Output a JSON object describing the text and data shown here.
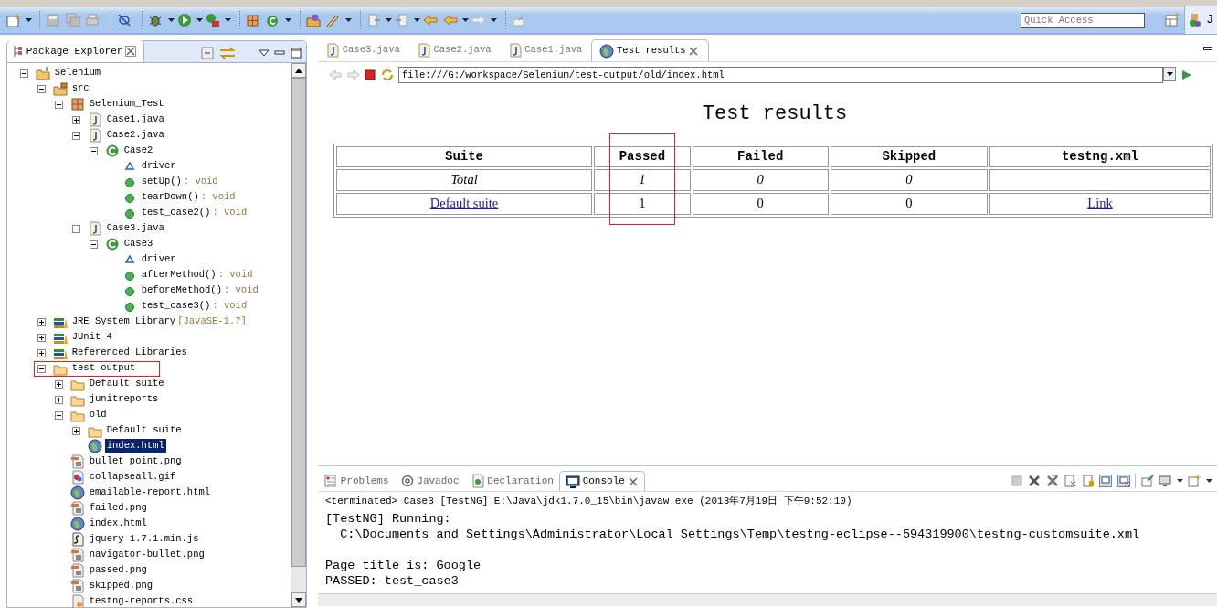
{
  "toolbar": {
    "quick_access": {
      "placeholder": "Quick Access"
    },
    "perspective_label": "J"
  },
  "package_explorer": {
    "title": "Package Explorer",
    "tree": [
      {
        "label": "Selenium",
        "kind": "project",
        "expanded": true,
        "children": [
          {
            "label": "src",
            "kind": "source-folder",
            "expanded": true,
            "children": [
              {
                "label": "Selenium_Test",
                "kind": "package",
                "expanded": true,
                "children": [
                  {
                    "label": "Case1.java",
                    "kind": "java-file",
                    "expanded": false
                  },
                  {
                    "label": "Case2.java",
                    "kind": "java-file",
                    "expanded": true,
                    "children": [
                      {
                        "label": "Case2",
                        "kind": "class",
                        "expanded": true,
                        "children": [
                          {
                            "label": "driver",
                            "kind": "field"
                          },
                          {
                            "label": "setUp()",
                            "suffix": " : void",
                            "kind": "method"
                          },
                          {
                            "label": "tearDown()",
                            "suffix": " : void",
                            "kind": "method"
                          },
                          {
                            "label": "test_case2()",
                            "suffix": " : void",
                            "kind": "method"
                          }
                        ]
                      }
                    ]
                  },
                  {
                    "label": "Case3.java",
                    "kind": "java-file",
                    "expanded": true,
                    "children": [
                      {
                        "label": "Case3",
                        "kind": "class",
                        "expanded": true,
                        "children": [
                          {
                            "label": "driver",
                            "kind": "field"
                          },
                          {
                            "label": "afterMethod()",
                            "suffix": " : void",
                            "kind": "method"
                          },
                          {
                            "label": "beforeMethod()",
                            "suffix": " : void",
                            "kind": "method"
                          },
                          {
                            "label": "test_case3()",
                            "suffix": " : void",
                            "kind": "method"
                          }
                        ]
                      }
                    ]
                  }
                ]
              }
            ]
          },
          {
            "label": "JRE System Library",
            "suffix": " [JavaSE-1.7]",
            "kind": "library",
            "expanded": false
          },
          {
            "label": "JUnit 4",
            "kind": "library",
            "expanded": false
          },
          {
            "label": "Referenced Libraries",
            "kind": "library",
            "expanded": false
          },
          {
            "label": "test-output",
            "kind": "folder",
            "expanded": true,
            "highlighted": true,
            "children": [
              {
                "label": "Default suite",
                "kind": "folder",
                "expanded": false
              },
              {
                "label": "junitreports",
                "kind": "folder",
                "expanded": false
              },
              {
                "label": "old",
                "kind": "folder",
                "expanded": true,
                "children": [
                  {
                    "label": "Default suite",
                    "kind": "folder",
                    "expanded": false
                  },
                  {
                    "label": "index.html",
                    "kind": "web-file",
                    "selected": true
                  }
                ]
              },
              {
                "label": "bullet_point.png",
                "kind": "image-file",
                "selected": false
              },
              {
                "label": "collapseall.gif",
                "kind": "gif-file",
                "selected": false
              },
              {
                "label": "emailable-report.html",
                "kind": "web-file",
                "selected": false
              },
              {
                "label": "failed.png",
                "kind": "image-file",
                "selected": false
              },
              {
                "label": "index.html",
                "kind": "web-file",
                "selected": false
              },
              {
                "label": "jquery-1.7.1.min.js",
                "kind": "script-file",
                "selected": false
              },
              {
                "label": "navigator-bullet.png",
                "kind": "image-file",
                "selected": false
              },
              {
                "label": "passed.png",
                "kind": "image-file",
                "selected": false
              },
              {
                "label": "skipped.png",
                "kind": "image-file",
                "selected": false
              },
              {
                "label": "testng-reports.css",
                "kind": "css-file",
                "selected": false
              }
            ]
          }
        ]
      }
    ]
  },
  "editor": {
    "tabs": [
      {
        "label": "Case3.java",
        "kind": "java-file",
        "selected": false
      },
      {
        "label": "Case2.java",
        "kind": "java-file",
        "selected": false
      },
      {
        "label": "Case1.java",
        "kind": "java-file",
        "selected": false
      },
      {
        "label": "Test results",
        "kind": "web-file",
        "selected": true
      }
    ],
    "browser": {
      "url": "file:///G:/workspace/Selenium/test-output/old/index.html"
    },
    "page": {
      "heading": "Test results",
      "columns": [
        {
          "label": "Suite",
          "highlighted": false
        },
        {
          "label": "Passed",
          "highlighted": true
        },
        {
          "label": "Failed",
          "highlighted": false
        },
        {
          "label": "Skipped",
          "highlighted": false
        },
        {
          "label": "testng.xml",
          "highlighted": false
        }
      ],
      "rows": [
        {
          "kind": "total",
          "cells": [
            {
              "text": "Total"
            },
            {
              "text": "1"
            },
            {
              "text": "0"
            },
            {
              "text": "0"
            }
          ]
        },
        {
          "kind": "suite",
          "cells": [
            {
              "text": "Default suite",
              "link": true
            },
            {
              "text": "1"
            },
            {
              "text": "0"
            },
            {
              "text": "0"
            },
            {
              "text": "Link",
              "link": true
            }
          ]
        }
      ]
    }
  },
  "console": {
    "tabs": [
      {
        "label": "Problems",
        "kind": "problems",
        "selected": false
      },
      {
        "label": "Javadoc",
        "kind": "javadoc",
        "selected": false
      },
      {
        "label": "Declaration",
        "kind": "declaration",
        "selected": false
      },
      {
        "label": "Console",
        "kind": "console",
        "selected": true
      }
    ],
    "header": "<terminated> Case3 [TestNG] E:\\Java\\jdk1.7.0_15\\bin\\javaw.exe (2013年7月19日 下午9:52:10)",
    "output": "[TestNG] Running:\n  C:\\Documents and Settings\\Administrator\\Local Settings\\Temp\\testng-eclipse--594319900\\testng-customsuite.xml\n\nPage title is: Google\nPASSED: test_case3"
  }
}
